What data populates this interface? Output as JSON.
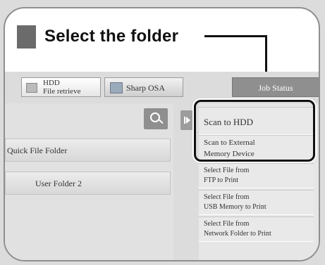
{
  "callout": {
    "title": "Select the folder"
  },
  "tabs": {
    "hdd": {
      "line1": "HDD",
      "line2": "File retrieve",
      "icon": "hdd-icon"
    },
    "sharp": {
      "label": "Sharp OSA",
      "icon": "sharp-osa-icon"
    },
    "job_status": {
      "label": "Job Status"
    }
  },
  "left_panel": {
    "search_icon": "search-icon",
    "folders": [
      "Quick File Folder",
      "User Folder 2"
    ]
  },
  "menu": {
    "expand_icon": "expand-arrow-icon",
    "items": [
      {
        "line1": "Scan to HDD",
        "line2": ""
      },
      {
        "line1": "Scan to External",
        "line2": "Memory Device"
      },
      {
        "line1": "Select File from",
        "line2": "FTP to Print"
      },
      {
        "line1": "Select File from",
        "line2": "USB Memory to Print"
      },
      {
        "line1": "Select File from",
        "line2": "Network Folder to Print"
      }
    ]
  },
  "colors": {
    "highlight_border": "#111111",
    "panel": "#e1e1e1",
    "job_status_bg": "#8f8f8f"
  }
}
